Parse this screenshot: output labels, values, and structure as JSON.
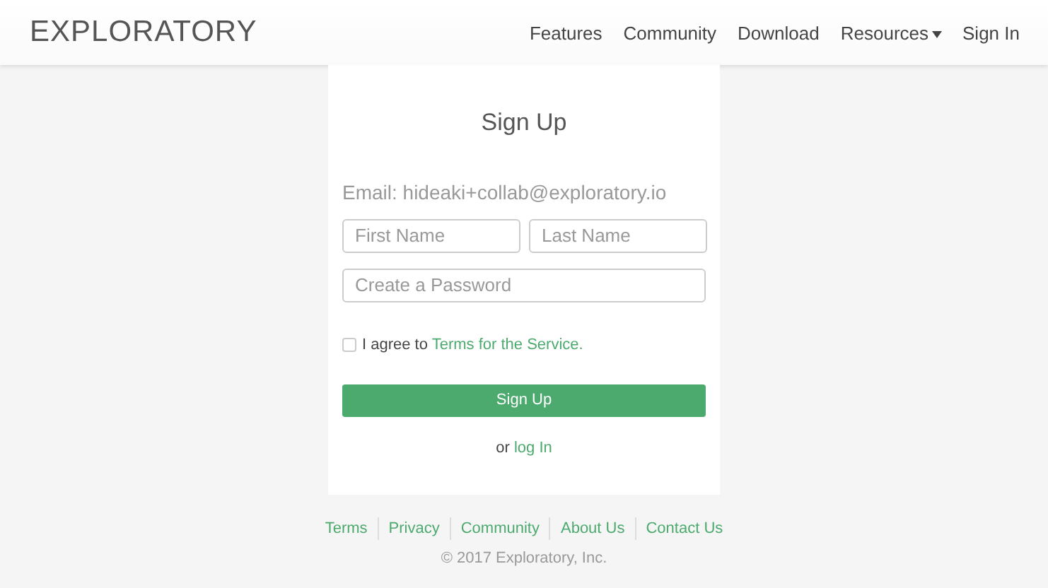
{
  "header": {
    "logo": "EXPLORATORY",
    "nav": [
      {
        "label": "Features",
        "kind": "link"
      },
      {
        "label": "Community",
        "kind": "link"
      },
      {
        "label": "Download",
        "kind": "link"
      },
      {
        "label": "Resources",
        "kind": "dropdown"
      },
      {
        "label": "Sign In",
        "kind": "link"
      }
    ]
  },
  "form": {
    "title": "Sign Up",
    "email": "Email: hideaki+collab@exploratory.io",
    "first_name": {
      "placeholder": "First Name"
    },
    "last_name": {
      "placeholder": "Last Name"
    },
    "password": {
      "placeholder": "Create a Password"
    },
    "agree": {
      "checked": false,
      "text": "I agree to",
      "link": "Terms for the Service."
    },
    "submit": "Sign Up",
    "login": {
      "text": "or",
      "link": "log In"
    }
  },
  "footer": {
    "links": [
      "Terms",
      "Privacy",
      "Community",
      "About Us",
      "Contact Us"
    ],
    "copyright": "© 2017 Exploratory, Inc."
  }
}
